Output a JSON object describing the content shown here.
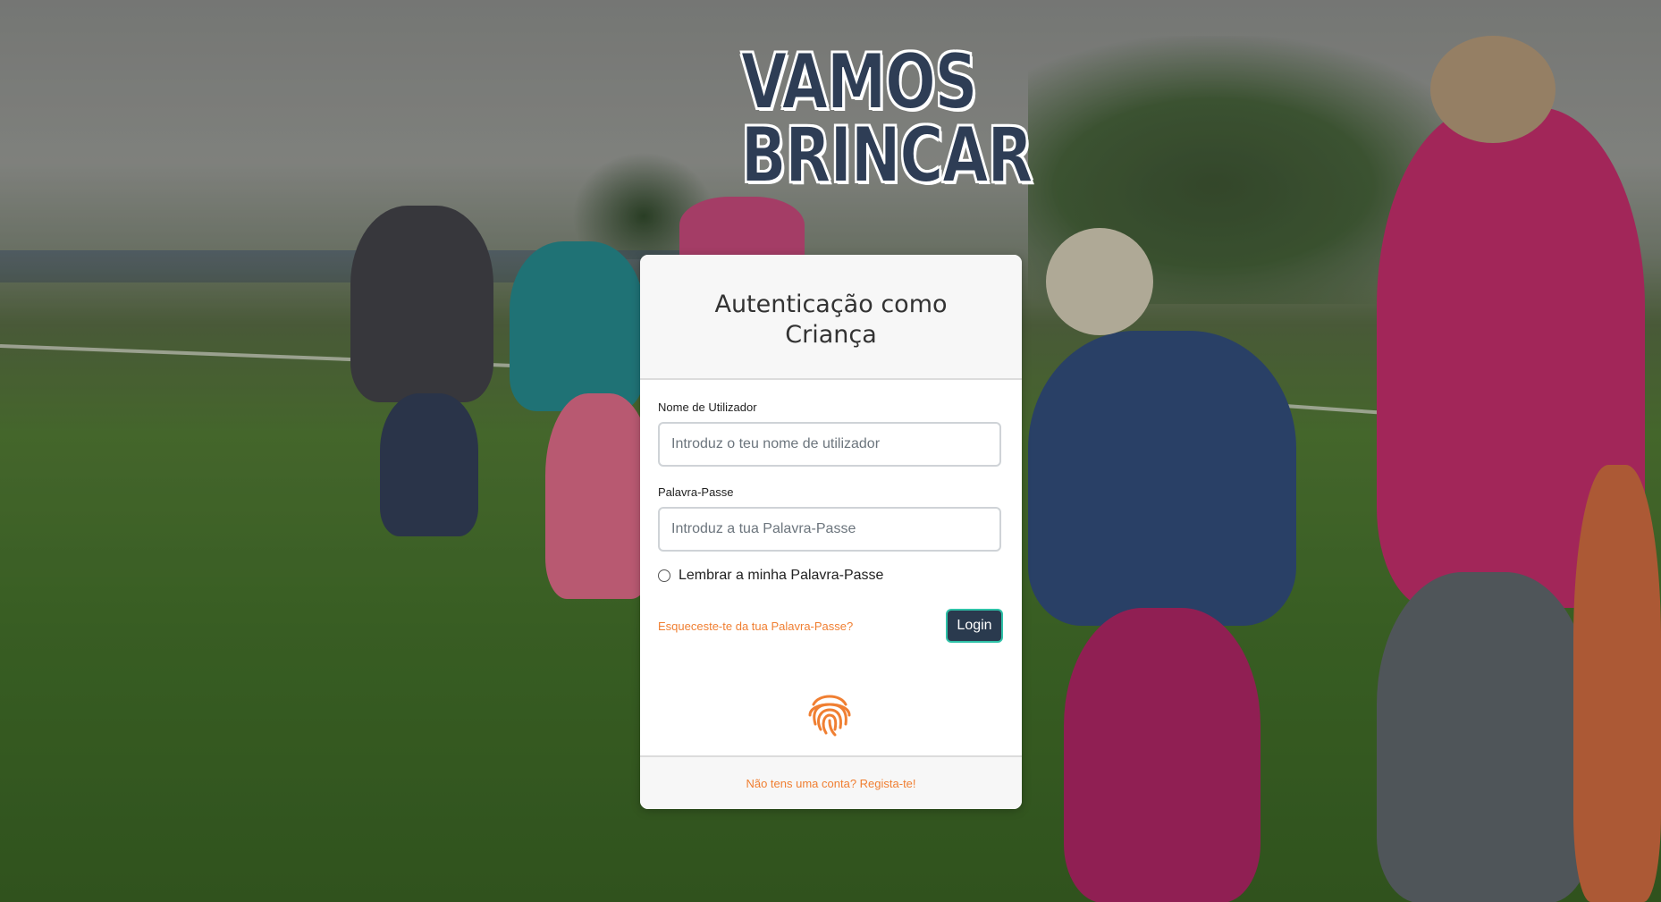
{
  "logo": {
    "line1": "VAMOS",
    "line2": "BRINCAR"
  },
  "card": {
    "title": "Autenticação como Criança",
    "username": {
      "label": "Nome de Utilizador",
      "placeholder": "Introduz o teu nome de utilizador",
      "value": ""
    },
    "password": {
      "label": "Palavra-Passe",
      "placeholder": "Introduz a tua Palavra-Passe",
      "value": ""
    },
    "remember": {
      "label": "Lembrar a minha Palavra-Passe",
      "checked": false
    },
    "forgot_link": "Esqueceste-te da tua Palavra-Passe?",
    "login_button": "Login",
    "fingerprint_icon": "fingerprint-icon",
    "register_link": "Não tens uma conta? Regista-te!"
  },
  "colors": {
    "accent_orange": "#f07f32",
    "button_bg": "#2a3a4e",
    "button_border": "#2fc2a8",
    "logo_text": "#2e3d55"
  }
}
